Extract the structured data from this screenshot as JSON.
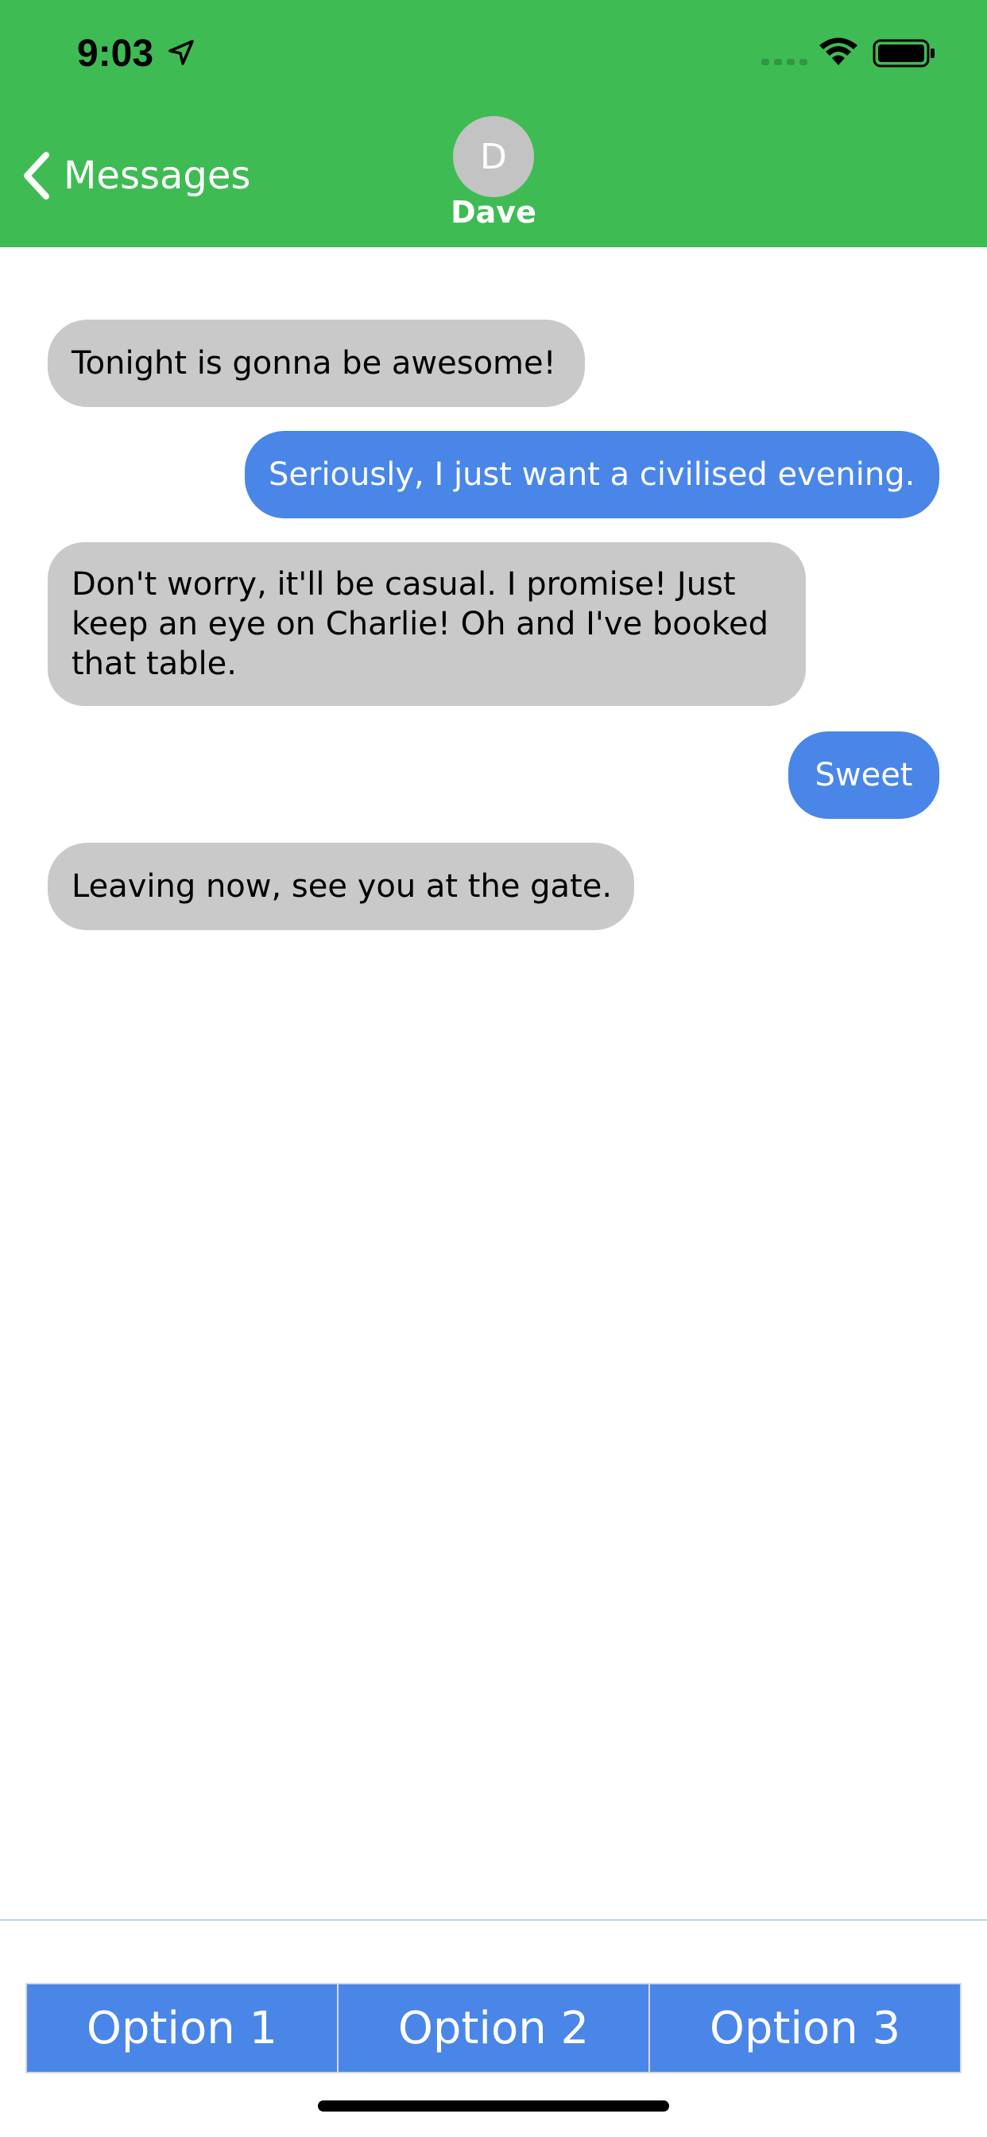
{
  "status_bar": {
    "time": "9:03"
  },
  "nav": {
    "back_label": "Messages",
    "avatar_initial": "D",
    "contact_name": "Dave"
  },
  "messages": [
    {
      "direction": "incoming",
      "text": "Tonight is gonna be awesome!"
    },
    {
      "direction": "outgoing",
      "text": "Seriously, I just want a civilised evening."
    },
    {
      "direction": "incoming",
      "text": "Don't worry, it'll be casual. I promise! Just keep an eye on Charlie! Oh and I've booked that table."
    },
    {
      "direction": "outgoing",
      "text": "Sweet"
    },
    {
      "direction": "incoming",
      "text": "Leaving now, see you at the gate."
    }
  ],
  "options": [
    "Option 1",
    "Option 2",
    "Option 3"
  ],
  "colors": {
    "header_green": "#3fbb54",
    "incoming_bubble": "#c9c9c9",
    "outgoing_bubble": "#4a86e8"
  }
}
